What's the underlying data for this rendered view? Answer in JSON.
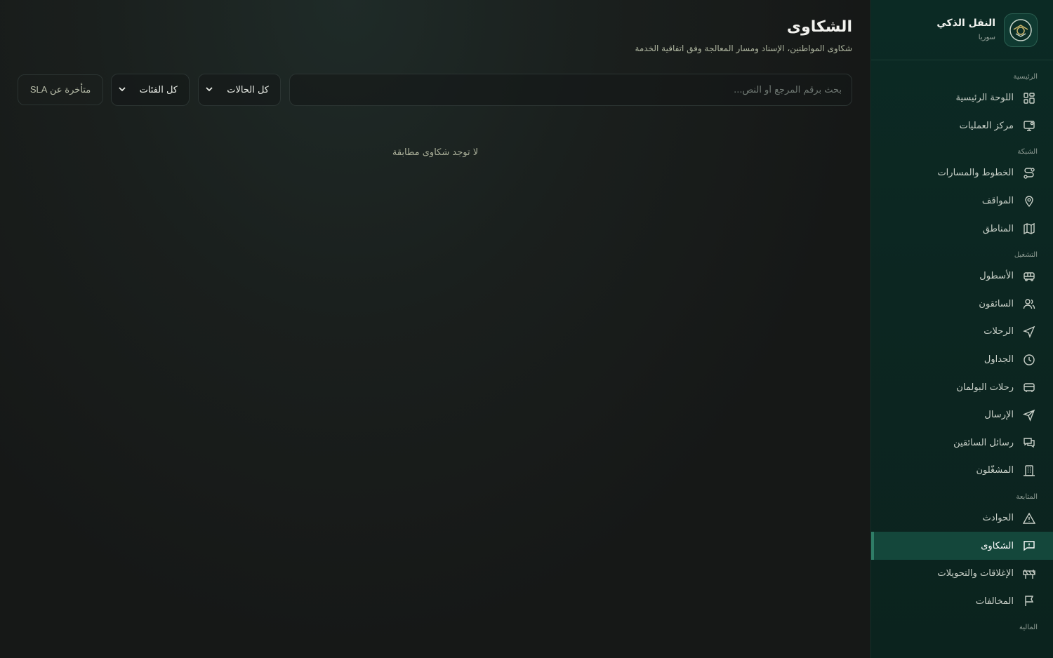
{
  "brand": {
    "title": "النقل الذكي",
    "subtitle": "سوريا"
  },
  "sidebar": {
    "sections": [
      {
        "label": "الرئيسية",
        "items": [
          {
            "label": "اللوحة الرئيسية",
            "icon": "dashboard-icon"
          },
          {
            "label": "مركز العمليات",
            "icon": "monitor-icon"
          }
        ]
      },
      {
        "label": "الشبكة",
        "items": [
          {
            "label": "الخطوط والمسارات",
            "icon": "route-icon"
          },
          {
            "label": "المواقف",
            "icon": "map-pin-icon"
          },
          {
            "label": "المناطق",
            "icon": "map-icon"
          }
        ]
      },
      {
        "label": "التشغيل",
        "items": [
          {
            "label": "الأسطول",
            "icon": "bus-icon"
          },
          {
            "label": "السائقون",
            "icon": "users-icon"
          },
          {
            "label": "الرحلات",
            "icon": "navigation-icon"
          },
          {
            "label": "الجداول",
            "icon": "clock-icon"
          },
          {
            "label": "رحلات البولمان",
            "icon": "coach-icon"
          },
          {
            "label": "الإرسال",
            "icon": "send-icon"
          },
          {
            "label": "رسائل السائقين",
            "icon": "chat-icon"
          },
          {
            "label": "المشغّلون",
            "icon": "building-icon"
          }
        ]
      },
      {
        "label": "المتابعة",
        "items": [
          {
            "label": "الحوادث",
            "icon": "warning-icon"
          },
          {
            "label": "الشكاوى",
            "icon": "complaint-icon",
            "active": true
          },
          {
            "label": "الإغلاقات والتحويلات",
            "icon": "barrier-icon"
          },
          {
            "label": "المخالفات",
            "icon": "flag-icon"
          }
        ]
      },
      {
        "label": "المالية",
        "items": []
      }
    ]
  },
  "page": {
    "title": "الشكاوى",
    "subtitle": "شكاوى المواطنين، الإسناد ومسار المعالجة وفق اتفاقية الخدمة"
  },
  "filters": {
    "search_placeholder": "بحث برقم المرجع أو النص...",
    "search_value": "",
    "status_selected": "كل الحالات",
    "category_selected": "كل الفئات",
    "sla_button": "متأخرة عن SLA"
  },
  "empty_state": "لا توجد شكاوى مطابقة",
  "colors": {
    "accent": "#14473b",
    "sidebar_bg": "#0b2a24",
    "main_bg": "#171a19"
  }
}
